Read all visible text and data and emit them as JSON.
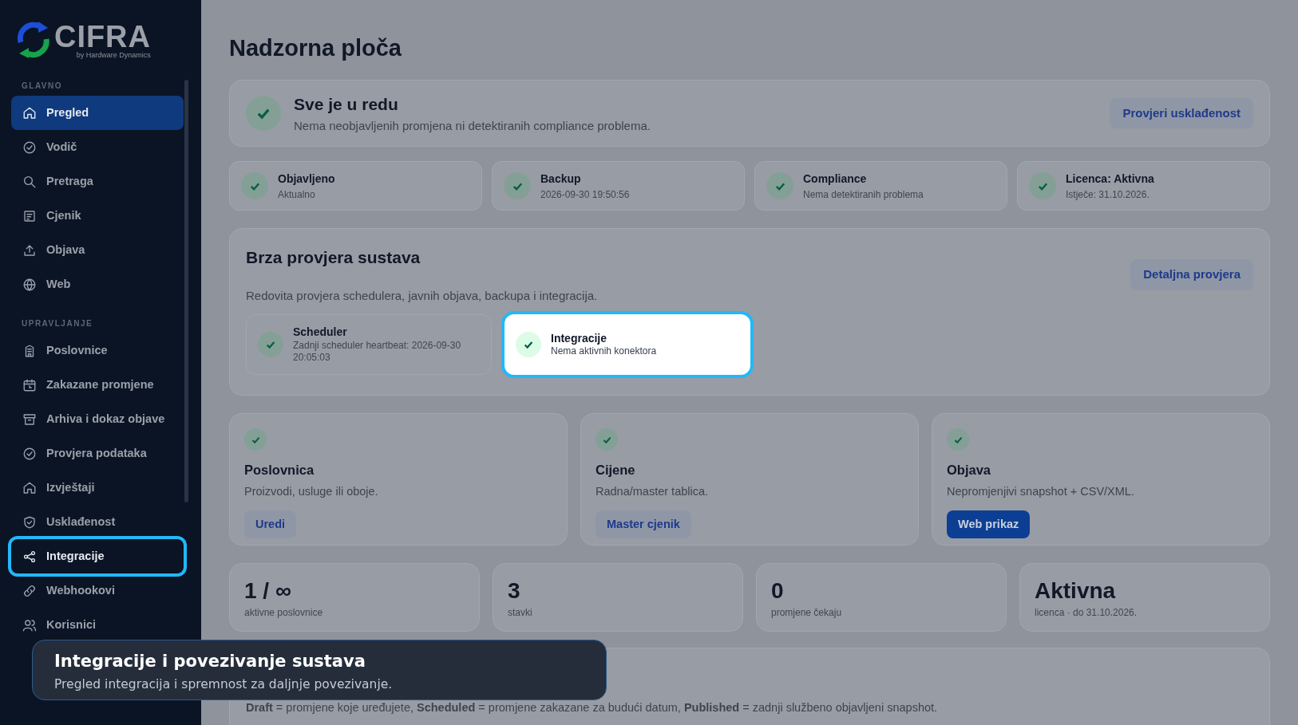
{
  "logo": {
    "name": "CIFRA",
    "tagline": "by Hardware Dynamics"
  },
  "sidebar": {
    "sections": [
      {
        "label": "GLAVNO",
        "items": [
          {
            "label": "Pregled",
            "kind": "home",
            "selected": true,
            "highlighted": false
          },
          {
            "label": "Vodič",
            "kind": "check-circle",
            "selected": false,
            "highlighted": false
          },
          {
            "label": "Pretraga",
            "kind": "search",
            "selected": false,
            "highlighted": false
          },
          {
            "label": "Cjenik",
            "kind": "list",
            "selected": false,
            "highlighted": false
          },
          {
            "label": "Objava",
            "kind": "upload",
            "selected": false,
            "highlighted": false
          },
          {
            "label": "Web",
            "kind": "globe",
            "selected": false,
            "highlighted": false
          }
        ]
      },
      {
        "label": "UPRAVLJANJE",
        "items": [
          {
            "label": "Poslovnice",
            "kind": "building",
            "selected": false,
            "highlighted": false
          },
          {
            "label": "Zakazane promjene",
            "kind": "calendar",
            "selected": false,
            "highlighted": false
          },
          {
            "label": "Arhiva i dokaz objave",
            "kind": "archive",
            "selected": false,
            "highlighted": false
          },
          {
            "label": "Provjera podataka",
            "kind": "check-circle",
            "selected": false,
            "highlighted": false
          },
          {
            "label": "Izvještaji",
            "kind": "home",
            "selected": false,
            "highlighted": false
          },
          {
            "label": "Usklađenost",
            "kind": "shield",
            "selected": false,
            "highlighted": false
          },
          {
            "label": "Integracije",
            "kind": "share",
            "selected": false,
            "highlighted": true
          },
          {
            "label": "Webhookovi",
            "kind": "link",
            "selected": false,
            "highlighted": false
          },
          {
            "label": "Korisnici",
            "kind": "users",
            "selected": false,
            "highlighted": false
          }
        ]
      }
    ]
  },
  "page_title": "Nadzorna ploča",
  "status_banner": {
    "title": "Sve je u redu",
    "message": "Nema neobjavljenih promjena ni detektiranih compliance problema.",
    "button": "Provjeri usklađenost"
  },
  "status_cards": [
    {
      "title": "Objavljeno",
      "subtitle": "Aktualno"
    },
    {
      "title": "Backup",
      "subtitle": "2026-09-30 19:50:56"
    },
    {
      "title": "Compliance",
      "subtitle": "Nema detektiranih problema"
    },
    {
      "title": "Licenca: Aktivna",
      "subtitle": "Istječe: 31.10.2026."
    }
  ],
  "quick_check": {
    "title": "Brza provjera sustava",
    "description": "Redovita provjera schedulera, javnih objava, backupa i integracija.",
    "button": "Detaljna provjera",
    "items": [
      {
        "title": "Scheduler",
        "subtitle": "Zadnji scheduler heartbeat: 2026-09-30 20:05:03",
        "highlighted": false
      },
      {
        "title": "Integracije",
        "subtitle": "Nema aktivnih konektora",
        "highlighted": true
      }
    ]
  },
  "feature_cards": [
    {
      "title": "Poslovnica",
      "description": "Proizvodi, usluge ili oboje.",
      "button": "Uredi",
      "primary": false
    },
    {
      "title": "Cijene",
      "description": "Radna/master tablica.",
      "button": "Master cjenik",
      "primary": false
    },
    {
      "title": "Objava",
      "description": "Nepromjenjivi snapshot + CSV/XML.",
      "button": "Web prikaz",
      "primary": true
    }
  ],
  "stats": [
    {
      "value": "1 / ∞",
      "label": "aktivne poslovnice"
    },
    {
      "value": "3",
      "label": "stavki"
    },
    {
      "value": "0",
      "label": "promjene čekaju"
    },
    {
      "value": "Aktivna",
      "label": "licenca · do 31.10.2026."
    }
  ],
  "legend": "**Draft** = promjene koje uređujete, **Scheduled** = promjene zakazane za budući datum, **Published** = zadnji službeno objavljeni snapshot.",
  "tour": {
    "title": "Integracije i povezivanje sustava",
    "text": "Pregled integracija i spremnost za daljnje povezivanje."
  }
}
